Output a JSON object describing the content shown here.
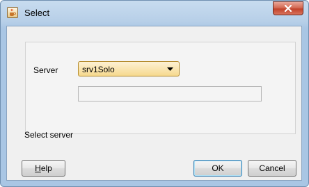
{
  "window": {
    "title": "Select",
    "close_icon": "close-icon",
    "app_icon": "java-cup-icon"
  },
  "form": {
    "server_label": "Server",
    "server_selected": "srv1Solo",
    "secondary_value": ""
  },
  "status_text": "Select server",
  "buttons": {
    "help_mnemonic": "H",
    "help_rest": "elp",
    "ok": "OK",
    "cancel": "Cancel"
  },
  "colors": {
    "close_button": "#c2432b",
    "select_bg": "#f6d98e",
    "title_bg": "#b7cfe8"
  }
}
